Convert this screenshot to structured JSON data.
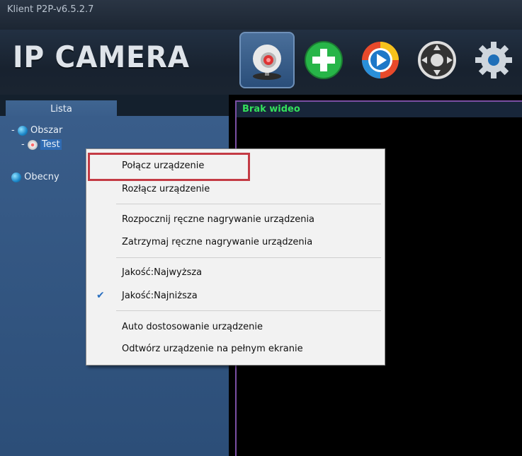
{
  "window": {
    "title": "Klient P2P-v6.5.2.7"
  },
  "header": {
    "logo_text": "IP CAMERA",
    "toolbar": [
      {
        "name": "camera",
        "icon": "webcam-icon",
        "active": true
      },
      {
        "name": "add",
        "icon": "plus-icon"
      },
      {
        "name": "play",
        "icon": "play-icon"
      },
      {
        "name": "ptz",
        "icon": "ptz-control-icon"
      },
      {
        "name": "settings",
        "icon": "gear-icon"
      }
    ]
  },
  "sidebar": {
    "tab_label": "Lista",
    "tree": {
      "area_label": "Obszar",
      "device_label": "Test",
      "online_label": "Obecny"
    }
  },
  "video": {
    "status": "Brak wideo"
  },
  "context_menu": {
    "items": [
      "Połącz urządzenie",
      "Rozłącz urządzenie",
      "Rozpocznij ręczne nagrywanie urządzenia",
      "Zatrzymaj ręczne nagrywanie urządzenia",
      "Jakość:Najwyższa",
      "Jakość:Najniższa",
      "Auto dostosowanie urządzenie",
      "Odtwórz urządzenie na pełnym ekranie"
    ],
    "checked_item": "Jakość:Najniższa",
    "highlighted_item": "Połącz urządzenie"
  },
  "colors": {
    "accent_red": "#c43b45",
    "status_green": "#34e05c",
    "sidebar_blue": "#3a5e8b"
  }
}
